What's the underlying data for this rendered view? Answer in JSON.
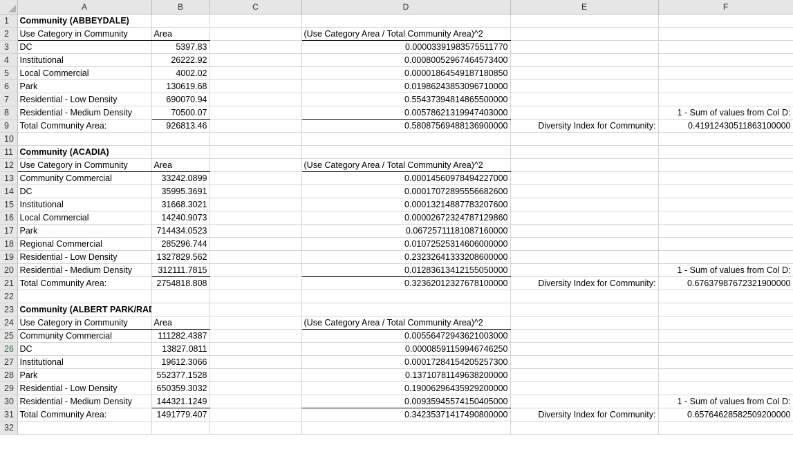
{
  "columns": [
    "A",
    "B",
    "C",
    "D",
    "E",
    "F"
  ],
  "rows": [
    {
      "n": "1",
      "A": "Community (ABBEYDALE)",
      "B": "",
      "D": "",
      "E": "",
      "F": "",
      "boldA": true
    },
    {
      "n": "2",
      "A": "Use Category in Community",
      "B": "Area",
      "D": "(Use Category Area / Total Community Area)^2",
      "E": "",
      "F": "",
      "hdr": true
    },
    {
      "n": "3",
      "A": "DC",
      "B": "5397.83",
      "D": "0.00003391983575511770",
      "E": "",
      "F": ""
    },
    {
      "n": "4",
      "A": "Institutional",
      "B": "26222.92",
      "D": "0.00080052967464573400",
      "E": "",
      "F": ""
    },
    {
      "n": "5",
      "A": "Local Commercial",
      "B": "4002.02",
      "D": "0.00001864549187180850",
      "E": "",
      "F": ""
    },
    {
      "n": "6",
      "A": "Park",
      "B": "130619.68",
      "D": "0.01986243853096710000",
      "E": "",
      "F": ""
    },
    {
      "n": "7",
      "A": "Residential - Low Density",
      "B": "690070.94",
      "D": "0.55437394814865500000",
      "E": "",
      "F": ""
    },
    {
      "n": "8",
      "A": "Residential - Medium Density",
      "B": "70500.07",
      "D": "0.00578621319947403000",
      "E": "",
      "F": "1 - Sum of values from Col D:",
      "last": true
    },
    {
      "n": "9",
      "A": "Total Community Area:",
      "B": "926813.46",
      "D": "0.58087569488136900000",
      "E": "Diversity Index for Community:",
      "F": "0.41912430511863100000"
    },
    {
      "n": "10",
      "A": "",
      "B": "",
      "D": "",
      "E": "",
      "F": ""
    },
    {
      "n": "11",
      "A": "Community (ACADIA)",
      "B": "",
      "D": "",
      "E": "",
      "F": "",
      "boldA": true
    },
    {
      "n": "12",
      "A": "Use Category in Community",
      "B": "Area",
      "D": "(Use Category Area / Total Community Area)^2",
      "E": "",
      "F": "",
      "hdr": true
    },
    {
      "n": "13",
      "A": "Community Commercial",
      "B": "33242.0899",
      "D": "0.00014560978494227000",
      "E": "",
      "F": ""
    },
    {
      "n": "14",
      "A": "DC",
      "B": "35995.3691",
      "D": "0.00017072895556682600",
      "E": "",
      "F": ""
    },
    {
      "n": "15",
      "A": "Institutional",
      "B": "31668.3021",
      "D": "0.00013214887783207600",
      "E": "",
      "F": ""
    },
    {
      "n": "16",
      "A": "Local Commercial",
      "B": "14240.9073",
      "D": "0.00002672324787129860",
      "E": "",
      "F": ""
    },
    {
      "n": "17",
      "A": "Park",
      "B": "714434.0523",
      "D": "0.06725711181087160000",
      "E": "",
      "F": ""
    },
    {
      "n": "18",
      "A": "Regional Commercial",
      "B": "285296.744",
      "D": "0.01072525314606000000",
      "E": "",
      "F": ""
    },
    {
      "n": "19",
      "A": "Residential - Low Density",
      "B": "1327829.562",
      "D": "0.23232641333208600000",
      "E": "",
      "F": ""
    },
    {
      "n": "20",
      "A": "Residential - Medium Density",
      "B": "312111.7815",
      "D": "0.01283613412155050000",
      "E": "",
      "F": "1 - Sum of values from Col D:",
      "last": true
    },
    {
      "n": "21",
      "A": "Total Community Area:",
      "B": "2754818.808",
      "D": "0.32362012327678100000",
      "E": "Diversity Index for Community:",
      "F": "0.67637987672321900000"
    },
    {
      "n": "22",
      "A": "",
      "B": "",
      "D": "",
      "E": "",
      "F": ""
    },
    {
      "n": "23",
      "A": "Community (ALBERT PARK/RADISSON HEIGHTS)",
      "B": "",
      "D": "",
      "E": "",
      "F": "",
      "boldA": true
    },
    {
      "n": "24",
      "A": "Use Category in Community",
      "B": "Area",
      "D": "(Use Category Area / Total Community Area)^2",
      "E": "",
      "F": "",
      "hdr": true
    },
    {
      "n": "25",
      "A": "Community Commercial",
      "B": "111282.4387",
      "D": "0.00556472943621003000",
      "E": "",
      "F": ""
    },
    {
      "n": "26",
      "A": "DC",
      "B": "13827.0811",
      "D": "0.00008591159946746250",
      "E": "",
      "F": "",
      "active": true
    },
    {
      "n": "27",
      "A": "Institutional",
      "B": "19612.3066",
      "D": "0.00017284154205257300",
      "E": "",
      "F": ""
    },
    {
      "n": "28",
      "A": "Park",
      "B": "552377.1528",
      "D": "0.13710781149638200000",
      "E": "",
      "F": ""
    },
    {
      "n": "29",
      "A": "Residential - Low Density",
      "B": "650359.3032",
      "D": "0.19006296435929200000",
      "E": "",
      "F": ""
    },
    {
      "n": "30",
      "A": "Residential - Medium Density",
      "B": "144321.1249",
      "D": "0.00935945574150405000",
      "E": "",
      "F": "1 - Sum of values from Col D:",
      "last": true
    },
    {
      "n": "31",
      "A": "Total Community Area:",
      "B": "1491779.407",
      "D": "0.34235371417490800000",
      "E": "Diversity Index for Community:",
      "F": "0.65764628582509200000"
    },
    {
      "n": "32",
      "A": "",
      "B": "",
      "D": "",
      "E": "",
      "F": ""
    }
  ]
}
